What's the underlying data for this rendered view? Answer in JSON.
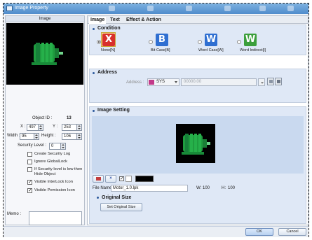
{
  "window": {
    "title": "Image Property"
  },
  "left": {
    "header": "Image",
    "object_id_label": "Object ID :",
    "object_id": "13",
    "x_label": "X :",
    "x": "497",
    "y_label": "Y :",
    "y": "253",
    "width_label": "Width :",
    "width": "95",
    "height_label": "Height :",
    "height": "106",
    "security_label": "Security Level :",
    "security": "0",
    "checks": [
      {
        "label": "Create Security Log",
        "checked": false
      },
      {
        "label": "Ignore GlobalLock",
        "checked": false
      },
      {
        "label": "If Security level is low then Hide Object",
        "checked": false
      },
      {
        "label": "Visible InterLock Icon",
        "checked": true
      },
      {
        "label": "Visible Pemission Icon",
        "checked": true
      }
    ],
    "memo_label": "Memo :"
  },
  "tabs": [
    "Image",
    "Text",
    "Effect & Action"
  ],
  "condition": {
    "title": "Condition",
    "options": [
      {
        "letter": "X",
        "label": "None[N]",
        "color": "#d8302c",
        "selected": true
      },
      {
        "letter": "B",
        "label": "Bit Case[B]",
        "color": "#2f6fd1",
        "selected": false
      },
      {
        "letter": "W",
        "label": "Word Case[W]",
        "color": "#2f6fd1",
        "selected": false
      },
      {
        "letter": "W",
        "label": "Word Indirect[I]",
        "color": "#3c9f3c",
        "selected": false
      }
    ]
  },
  "address": {
    "title": "Address",
    "label": "Address :",
    "device": "SYS",
    "value": "00000.00"
  },
  "image_setting": {
    "title": "Image Setting",
    "file_name_label": "File Name :",
    "file_name": "Motor_1.0.lpk",
    "w_label": "W:",
    "w": "100",
    "h_label": "H:",
    "h": "100",
    "original_size_title": "Original Size",
    "set_original_button": "Set Original Size"
  },
  "footer": {
    "ok": "OK",
    "cancel": "Cancel"
  },
  "colors": {
    "accent": "#2f5b9e",
    "canvas": "#c9d9ef",
    "motor": "#1f9c3f"
  }
}
